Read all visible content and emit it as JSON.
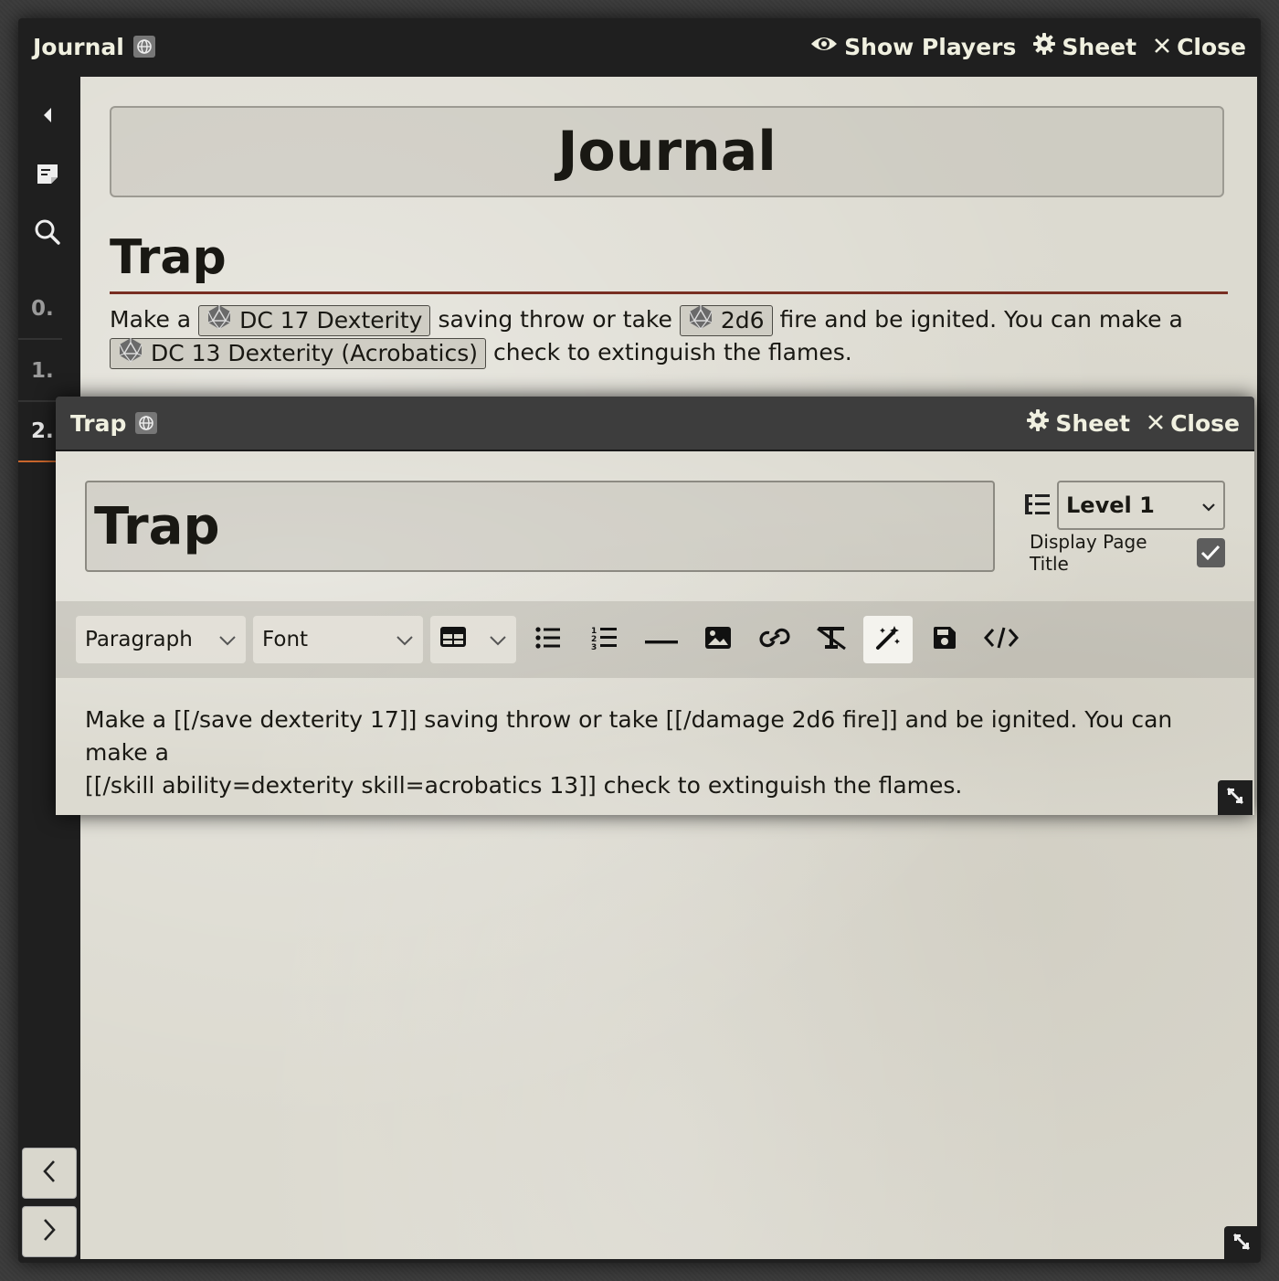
{
  "window": {
    "title": "Journal",
    "show_players_label": "Show Players",
    "sheet_label": "Sheet",
    "close_label": "Close"
  },
  "sidebar": {
    "pages": [
      {
        "number": "0.",
        "active": false
      },
      {
        "number": "1.",
        "active": false
      },
      {
        "number": "2.",
        "active": true
      }
    ]
  },
  "journal": {
    "heading": "Journal",
    "page_title": "Trap",
    "text": {
      "p1": "Make a",
      "chip1": "DC 17 Dexterity",
      "p2": "saving throw or take",
      "chip2": "2d6",
      "p3": "fire and be ignited. You can make a",
      "chip3": "DC 13 Dexterity (Acrobatics)",
      "p4": "check to extinguish the flames."
    }
  },
  "popup": {
    "title": "Trap",
    "sheet_label": "Sheet",
    "close_label": "Close",
    "page_title_value": "Trap",
    "level_value": "Level 1",
    "display_title_label": "Display Page Title",
    "display_title_checked": true,
    "toolbar": {
      "paragraph_label": "Paragraph",
      "font_label": "Font"
    },
    "editor_text_line1": "Make a [[/save dexterity 17]] saving throw or take [[/damage 2d6 fire]] and be ignited. You can make a",
    "editor_text_line2": "[[/skill ability=dexterity skill=acrobatics 13]] check to extinguish the flames."
  },
  "colors": {
    "accent_rule": "#782e22",
    "active_tab": "#c9662c",
    "parchment": "#dcdad0"
  }
}
